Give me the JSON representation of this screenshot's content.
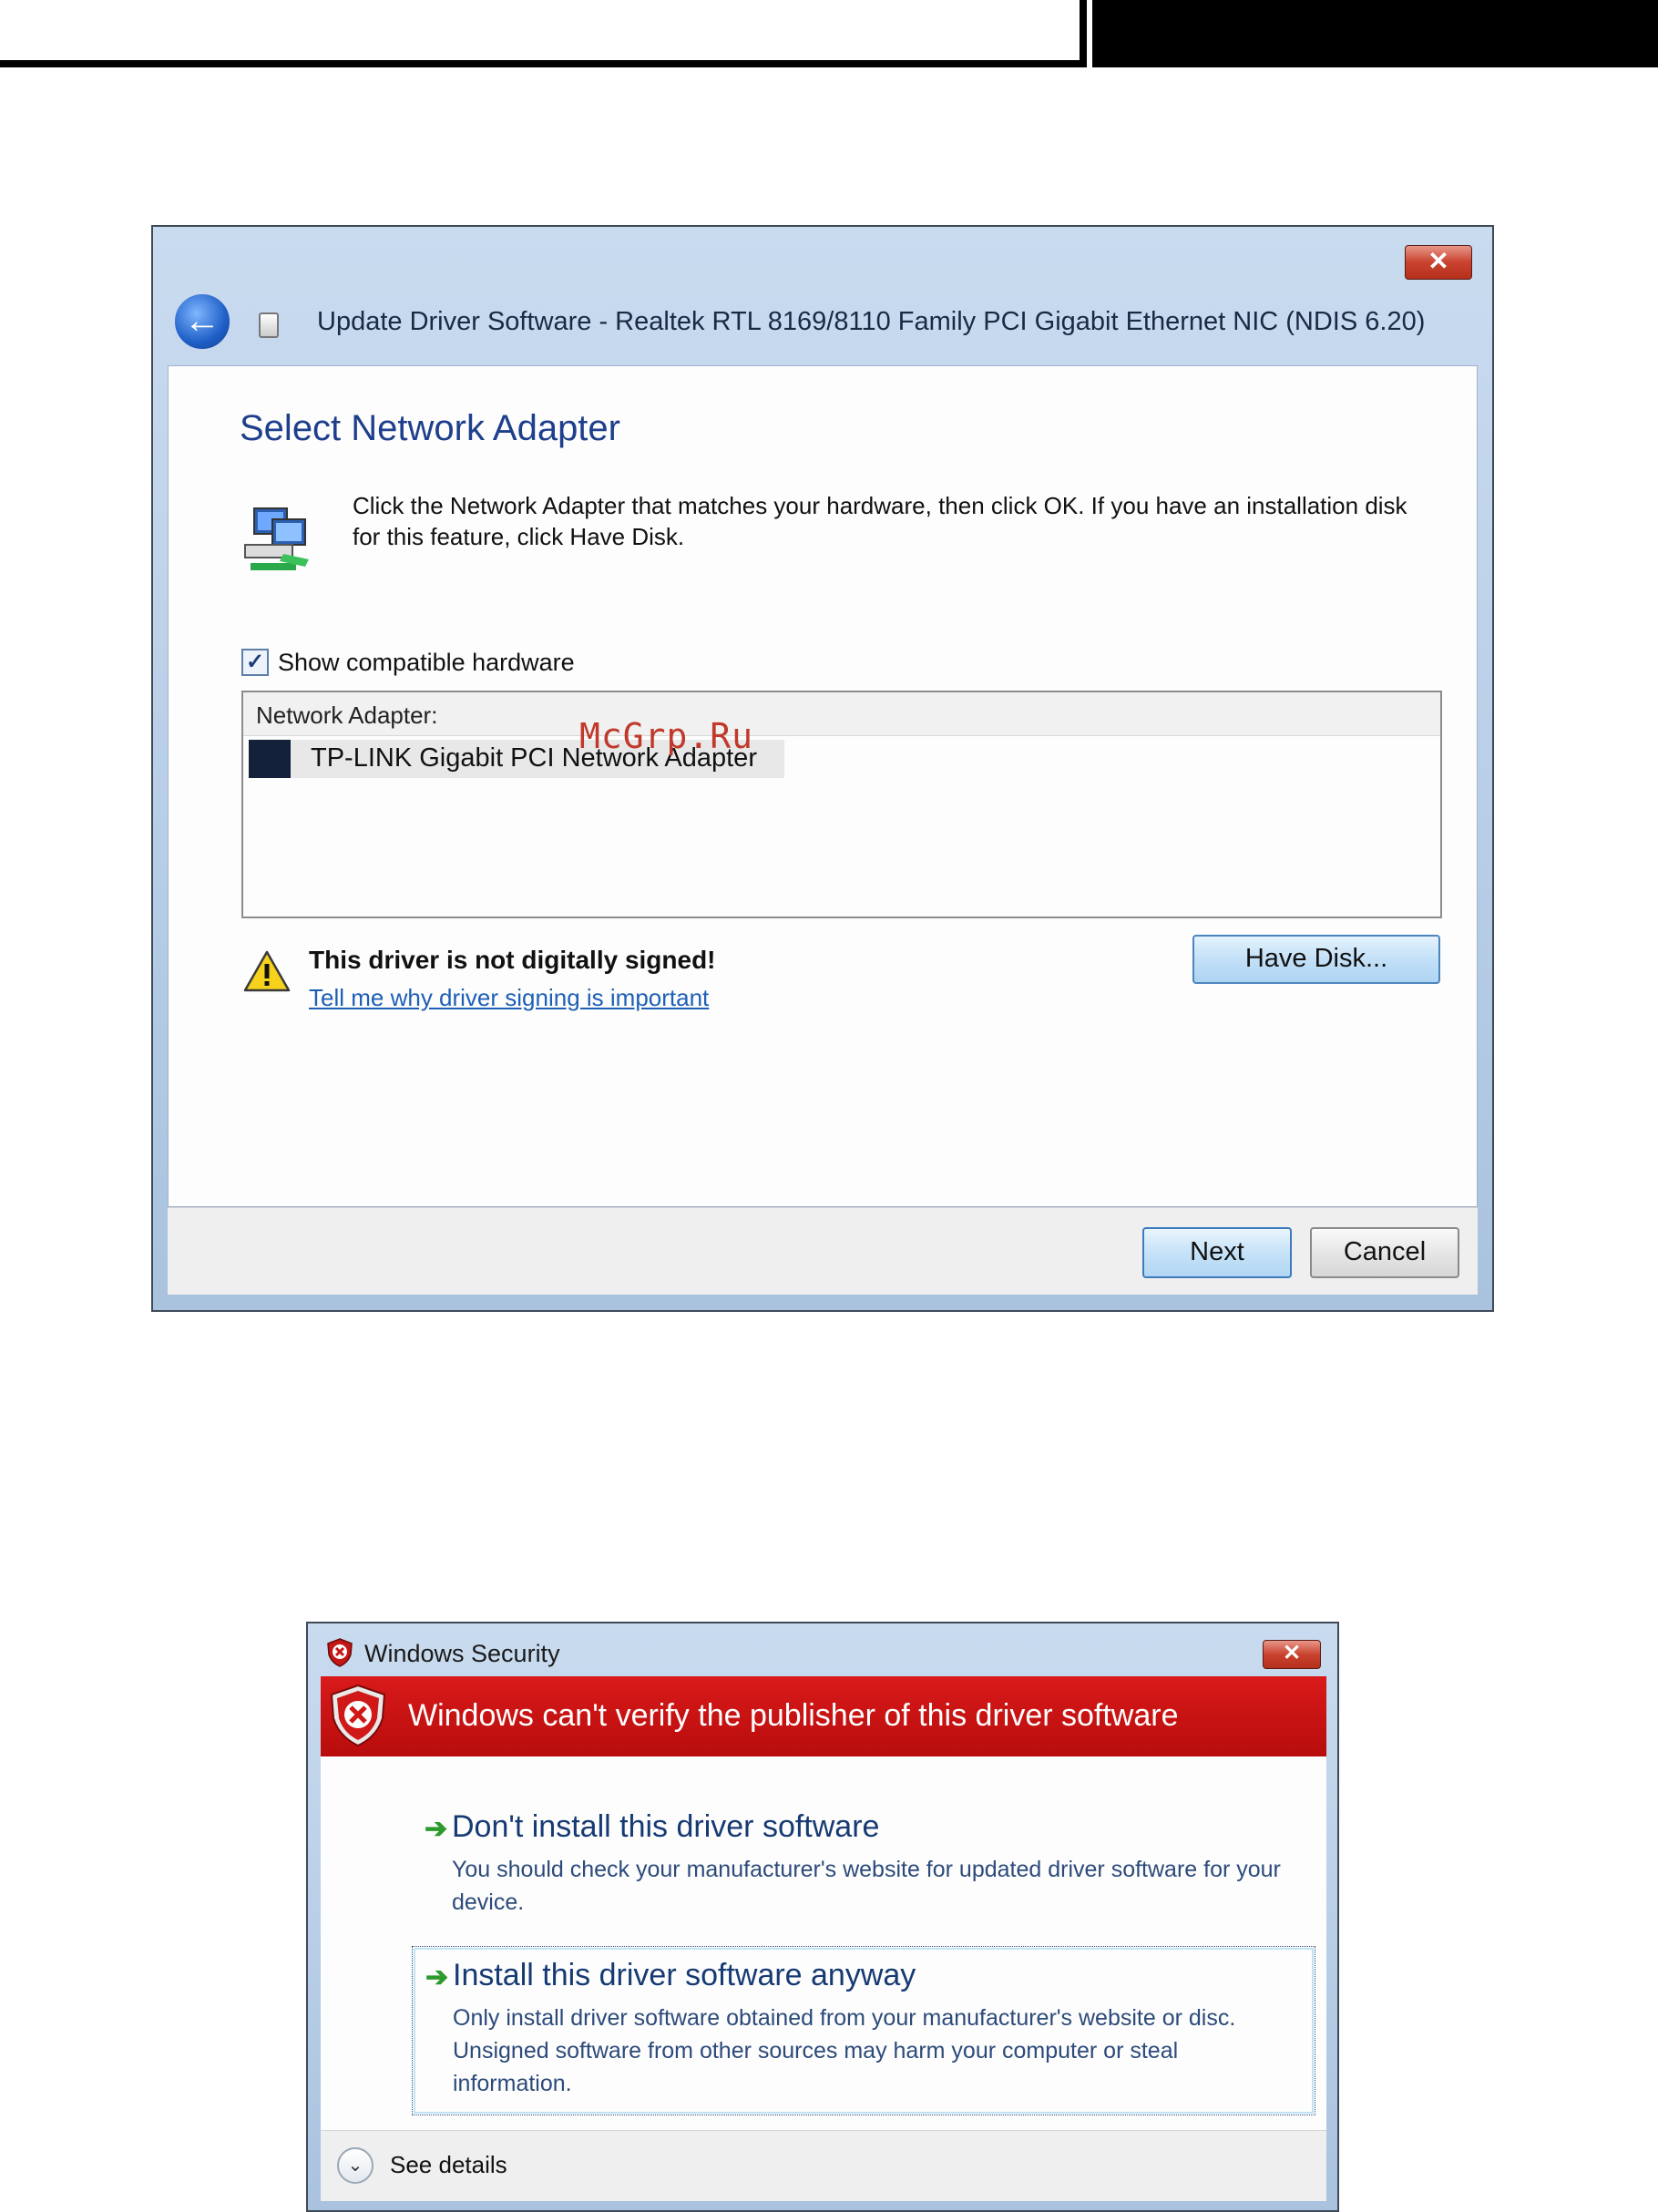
{
  "update_dialog": {
    "title": "Update Driver Software - Realtek RTL 8169/8110 Family PCI Gigabit Ethernet NIC (NDIS 6.20)",
    "close_label": "✕",
    "back_label": "←",
    "heading": "Select Network Adapter",
    "description": "Click the Network Adapter that matches your hardware, then click OK. If you have an installation disk for this feature, click Have Disk.",
    "show_compatible": {
      "label": "Show compatible hardware",
      "checked": true,
      "mark": "✓"
    },
    "list": {
      "header": "Network Adapter:",
      "items": [
        "TP-LINK Gigabit PCI Network Adapter"
      ]
    },
    "warning": {
      "text": "This driver is not digitally signed!",
      "link": "Tell me why driver signing is important"
    },
    "have_disk_label": "Have Disk...",
    "next_label": "Next",
    "cancel_label": "Cancel"
  },
  "watermark": "McGrp.Ru",
  "security_dialog": {
    "title": "Windows Security",
    "close_label": "✕",
    "banner": "Windows can't verify the publisher of this driver software",
    "options": [
      {
        "arrow": "➔",
        "title": "Don't install this driver software",
        "description": "You should check your manufacturer's website for updated driver software for your device."
      },
      {
        "arrow": "➔",
        "title": "Install this driver software anyway",
        "description": "Only install driver software obtained from your manufacturer's website or disc. Unsigned software from other sources may harm your computer or steal information."
      }
    ],
    "details_label": "See details",
    "details_chevron": "⌄"
  },
  "colors": {
    "heading": "#1e3f8c",
    "banner": "#c81010",
    "link": "#1d5fb6",
    "watermark": "#c0392b"
  }
}
